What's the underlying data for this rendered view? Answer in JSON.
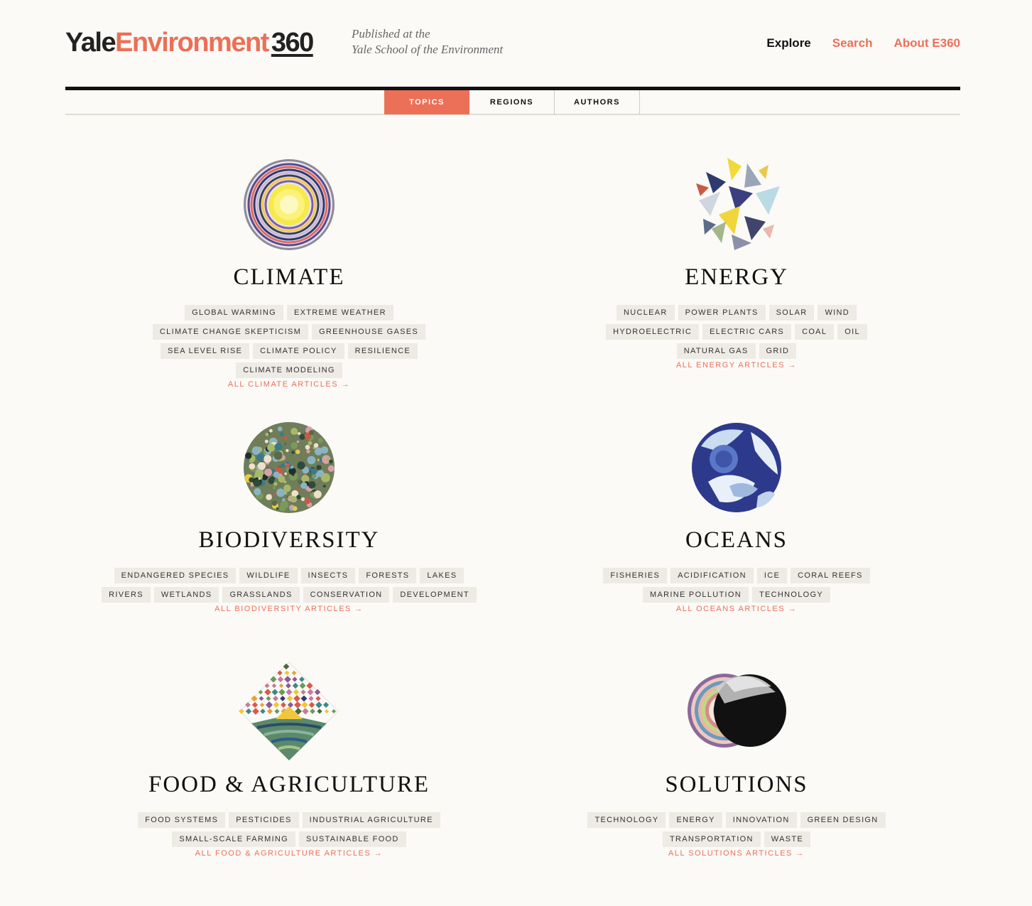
{
  "header": {
    "logo": {
      "part1": "Yale",
      "part2": "Environment",
      "part3": "360"
    },
    "tagline_line1": "Published at the",
    "tagline_line2": "Yale School of the Environment",
    "nav": {
      "explore": "Explore",
      "search": "Search",
      "about": "About E360"
    }
  },
  "tabs": [
    "TOPICS",
    "REGIONS",
    "AUTHORS"
  ],
  "colors": {
    "accent": "#ec6f57",
    "tag_bg": "#eeebe5",
    "page_bg": "#fbfaf7"
  },
  "topics": [
    {
      "title": "CLIMATE",
      "icon": "climate-rings-icon",
      "tags": [
        "GLOBAL WARMING",
        "EXTREME WEATHER",
        "CLIMATE CHANGE SKEPTICISM",
        "GREENHOUSE GASES",
        "SEA LEVEL RISE",
        "CLIMATE POLICY",
        "RESILIENCE",
        "CLIMATE MODELING"
      ],
      "all": "ALL CLIMATE ARTICLES →"
    },
    {
      "title": "ENERGY",
      "icon": "energy-shards-icon",
      "tags": [
        "NUCLEAR",
        "POWER PLANTS",
        "SOLAR",
        "WIND",
        "HYDROELECTRIC",
        "ELECTRIC CARS",
        "COAL",
        "OIL",
        "NATURAL GAS",
        "GRID"
      ],
      "all": "ALL ENERGY ARTICLES →"
    },
    {
      "title": "BIODIVERSITY",
      "icon": "biodiversity-dots-icon",
      "tags": [
        "ENDANGERED SPECIES",
        "WILDLIFE",
        "INSECTS",
        "FORESTS",
        "LAKES",
        "RIVERS",
        "WETLANDS",
        "GRASSLANDS",
        "CONSERVATION",
        "DEVELOPMENT"
      ],
      "all": "ALL BIODIVERSITY ARTICLES →"
    },
    {
      "title": "OCEANS",
      "icon": "oceans-globe-icon",
      "tags": [
        "FISHERIES",
        "ACIDIFICATION",
        "ICE",
        "CORAL REEFS",
        "MARINE POLLUTION",
        "TECHNOLOGY"
      ],
      "all": "ALL OCEANS ARTICLES →"
    },
    {
      "title": "FOOD & AGRICULTURE",
      "icon": "food-agriculture-diamond-icon",
      "tags": [
        "FOOD SYSTEMS",
        "PESTICIDES",
        "INDUSTRIAL AGRICULTURE",
        "SMALL-SCALE FARMING",
        "SUSTAINABLE FOOD"
      ],
      "all": "ALL FOOD & AGRICULTURE ARTICLES →"
    },
    {
      "title": "SOLUTIONS",
      "icon": "solutions-eclipse-icon",
      "tags": [
        "TECHNOLOGY",
        "ENERGY",
        "INNOVATION",
        "GREEN DESIGN",
        "TRANSPORTATION",
        "WASTE"
      ],
      "all": "ALL SOLUTIONS ARTICLES →"
    }
  ]
}
